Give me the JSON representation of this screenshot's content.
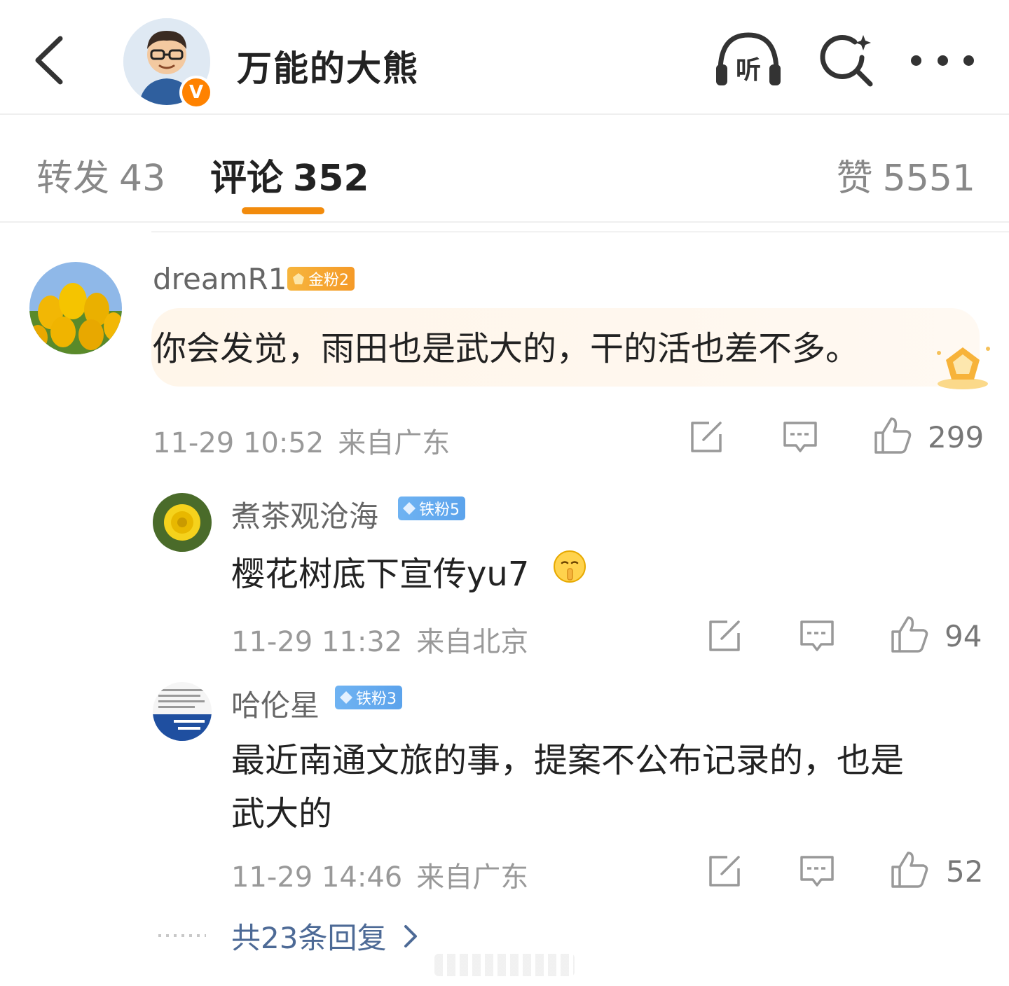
{
  "header": {
    "author_name": "万能的大熊",
    "verify_mark": "V",
    "listen_label": "听"
  },
  "tabs": {
    "repost_label": "转发",
    "repost_count": "43",
    "comment_label": "评论",
    "comment_count": "352",
    "like_label": "赞",
    "like_count": "5551"
  },
  "comments": [
    {
      "username": "dreamR1",
      "badge": "金粉2",
      "text": "你会发觉，雨田也是武大的，干的活也差不多。",
      "time": "11-29 10:52",
      "location": "来自广东",
      "likes": "299"
    },
    {
      "username": "煮茶观沧海",
      "badge": "铁粉5",
      "text": "樱花树底下宣传yu7",
      "time": "11-29 11:32",
      "location": "来自北京",
      "likes": "94"
    },
    {
      "username": "哈伦星",
      "badge": "铁粉3",
      "text_line1": "最近南通文旅的事，提案不公布记录的，也是",
      "text_line2": "武大的",
      "time": "11-29 14:46",
      "location": "来自广东",
      "likes": "52"
    }
  ],
  "reply_link": "共23条回复",
  "colors": {
    "accent": "#f28b0c",
    "link": "#4d6a96",
    "gold_badge": "#f59a28",
    "iron_badge": "#5ca3ec"
  }
}
